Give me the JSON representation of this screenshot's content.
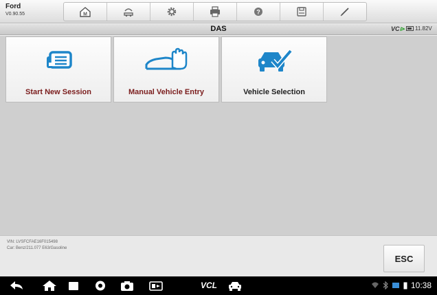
{
  "header": {
    "app_name": "Ford",
    "version": "V0.90.55",
    "toolbar": [
      {
        "icon": "home-icon"
      },
      {
        "icon": "vehicle-swap-icon"
      },
      {
        "icon": "settings-gear-icon"
      },
      {
        "icon": "printer-icon"
      },
      {
        "icon": "help-icon"
      },
      {
        "icon": "save-icon"
      },
      {
        "icon": "pen-icon"
      }
    ]
  },
  "titlebar": {
    "title": "DAS",
    "vci_prefix": "VC",
    "vci_status_color": "#2aa12a",
    "battery_voltage": "11.82V"
  },
  "tiles": [
    {
      "label": "Start New Session",
      "icon": "session-card-icon",
      "label_color": "#7a1c1c"
    },
    {
      "label": "Manual Vehicle Entry",
      "icon": "hand-car-icon",
      "label_color": "#7a1c1c"
    },
    {
      "label": "Vehicle Selection",
      "icon": "car-check-icon",
      "label_color": "#222222"
    }
  ],
  "footer": {
    "vin": "VIN: LVSFCFAE16F015498",
    "car": "Car: Benz/211.077 E63/Gasoline",
    "esc_label": "ESC"
  },
  "navbar": {
    "vcl_label": "VCL",
    "clock": "10:38"
  },
  "colors": {
    "icon_blue": "#1e86c9",
    "nav_bg": "#000000"
  }
}
